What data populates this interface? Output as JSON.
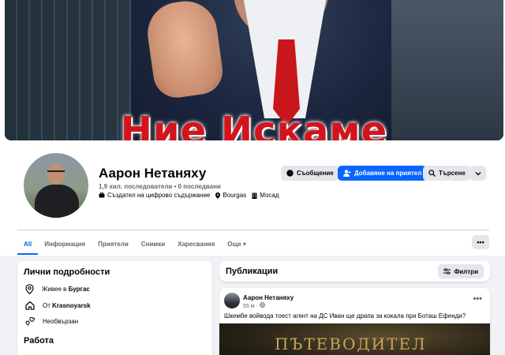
{
  "cover": {
    "text": "Ние Искаме"
  },
  "profile": {
    "name": "Аарон Нетаняху",
    "followers": "1,9 хил. последователи • 0 последвани",
    "meta": {
      "role": "Създател на цифрово съдържание",
      "city": "Bourgas",
      "work": "Мосад"
    }
  },
  "actions": {
    "message": "Съобщение",
    "add_friend": "Добавяне на приятел",
    "search": "Търсене"
  },
  "tabs": [
    {
      "label": "All"
    },
    {
      "label": "Информация"
    },
    {
      "label": "Приятели"
    },
    {
      "label": "Снимки"
    },
    {
      "label": "Харесвания"
    },
    {
      "label": "Още ▾"
    }
  ],
  "more_button": "•••",
  "details": {
    "title": "Лични подробности",
    "items": [
      {
        "prefix": "Живее в ",
        "value": "Бургас",
        "icon": "pin-icon"
      },
      {
        "prefix": "От ",
        "value": "Krasnoyarsk",
        "icon": "home-icon"
      },
      {
        "prefix": "",
        "value": "Необвързан",
        "icon": "hearts-icon"
      }
    ],
    "work_title": "Работа"
  },
  "posts": {
    "title": "Публикации",
    "filter": "Филтри"
  },
  "post": {
    "author": "Аарон Нетаняху",
    "time": "55 м ·",
    "text": "Шкембе войвода тоест агент на ДС Иван ще драпа за кокала при Боташ Ефенди?",
    "image_text": "ПЪТЕВОДИТЕЛ",
    "menu": "•••"
  },
  "colors": {
    "accent": "#0866ff",
    "page_bg": "#f0f2f5",
    "secondary_text": "#65676b"
  }
}
